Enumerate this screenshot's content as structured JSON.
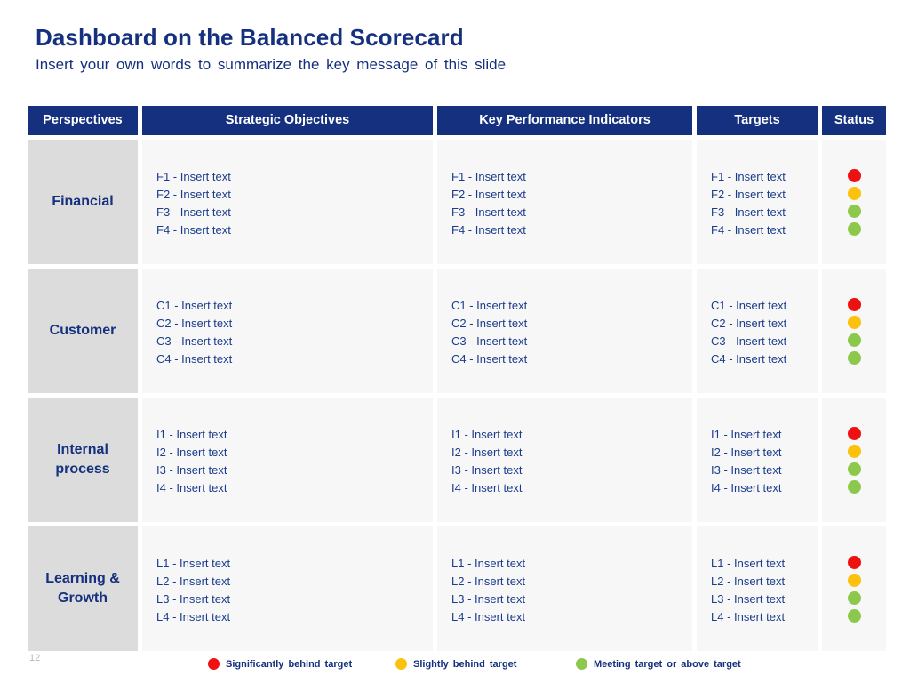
{
  "slide": {
    "title": "Dashboard on the Balanced Scorecard",
    "subtitle": "Insert your own words to summarize the key message of this slide",
    "page_number": "12",
    "accent_color": "#14307E",
    "perspective_cell_color": "#DCDCDC",
    "content_cell_color": "#F7F7F7"
  },
  "table": {
    "headers": [
      {
        "label": "Perspectives"
      },
      {
        "label": "Strategic Objectives"
      },
      {
        "label": "Key Performance Indicators"
      },
      {
        "label": "Targets"
      },
      {
        "label": "Status"
      }
    ],
    "rows": [
      {
        "perspective": "Financial",
        "objectives": [
          "F1 - Insert text",
          "F2 - Insert text",
          "F3 - Insert text",
          "F4 - Insert text"
        ],
        "kpis": [
          "F1 - Insert text",
          "F2 - Insert text",
          "F3 - Insert text",
          "F4 - Insert text"
        ],
        "targets": [
          "F1 - Insert text",
          "F2 - Insert text",
          "F3 - Insert text",
          "F4 - Insert text"
        ],
        "statuses": [
          "red",
          "amber",
          "green",
          "green"
        ]
      },
      {
        "perspective": "Customer",
        "objectives": [
          "C1 - Insert text",
          "C2 - Insert text",
          "C3 - Insert text",
          "C4 - Insert text"
        ],
        "kpis": [
          "C1 - Insert text",
          "C2 - Insert text",
          "C3 - Insert text",
          "C4 - Insert text"
        ],
        "targets": [
          "C1 - Insert text",
          "C2 - Insert text",
          "C3 - Insert text",
          "C4 - Insert text"
        ],
        "statuses": [
          "red",
          "amber",
          "green",
          "green"
        ]
      },
      {
        "perspective": "Internal process",
        "objectives": [
          "I1 - Insert text",
          "I2 - Insert text",
          "I3 - Insert text",
          "I4 - Insert text"
        ],
        "kpis": [
          "I1 - Insert text",
          "I2 - Insert text",
          "I3 - Insert text",
          "I4 - Insert text"
        ],
        "targets": [
          "I1 - Insert text",
          "I2 - Insert text",
          "I3 - Insert text",
          "I4 - Insert text"
        ],
        "statuses": [
          "red",
          "amber",
          "green",
          "green"
        ]
      },
      {
        "perspective": "Learning & Growth",
        "objectives": [
          "L1 - Insert text",
          "L2 - Insert text",
          "L3 - Insert text",
          "L4 - Insert text"
        ],
        "kpis": [
          "L1 - Insert text",
          "L2 - Insert text",
          "L3 - Insert text",
          "L4 - Insert text"
        ],
        "targets": [
          "L1 - Insert text",
          "L2 - Insert text",
          "L3 - Insert text",
          "L4 - Insert text"
        ],
        "statuses": [
          "red",
          "amber",
          "green",
          "green"
        ]
      }
    ]
  },
  "legend": {
    "items": [
      {
        "key": "red",
        "label": "Significantly behind target",
        "color": "#EE1111"
      },
      {
        "key": "amber",
        "label": "Slightly behind target",
        "color": "#FBC10D"
      },
      {
        "key": "green",
        "label": "Meeting target or above target",
        "color": "#8CC84B"
      }
    ]
  }
}
